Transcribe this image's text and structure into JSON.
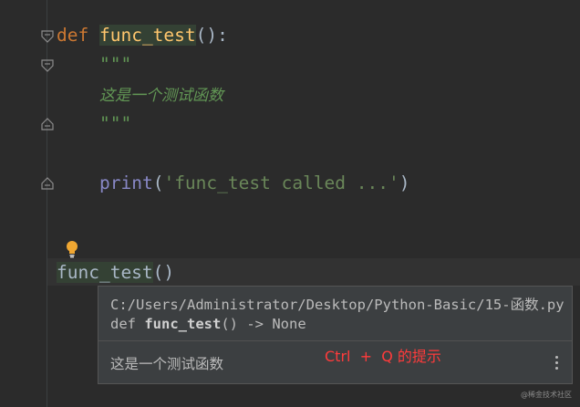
{
  "editor": {
    "line1": {
      "keyword": "def",
      "func_name": "func_test",
      "suffix": "():"
    },
    "docstring_open": "\"\"\"",
    "docstring_text": "这是一个测试函数",
    "docstring_close": "\"\"\"",
    "print_line": {
      "builtin": "print",
      "open": "(",
      "string": "'func_test called ...'",
      "close": ")"
    },
    "call_line": {
      "name": "func_test",
      "parens": "()"
    }
  },
  "quick_doc_popup": {
    "path": "C:/Users/Administrator/Desktop/Python-Basic/15-函数.py",
    "sig_keyword": "def",
    "sig_name": "func_test",
    "sig_rest": "() -> None",
    "doc": "这是一个测试函数"
  },
  "annotation": "Ctrl  +  Q 的提示",
  "watermark": "@稀金技术社区",
  "colors": {
    "background": "#2b2b2b",
    "keyword": "#cc7832",
    "function": "#ffc66d",
    "docstring": "#629755",
    "builtin": "#8888c6",
    "string": "#6a8759",
    "annotation": "#ff3b3b"
  },
  "icons": [
    "fold-arrow-icon",
    "fold-end-icon",
    "lightbulb-icon",
    "more-options-icon"
  ]
}
